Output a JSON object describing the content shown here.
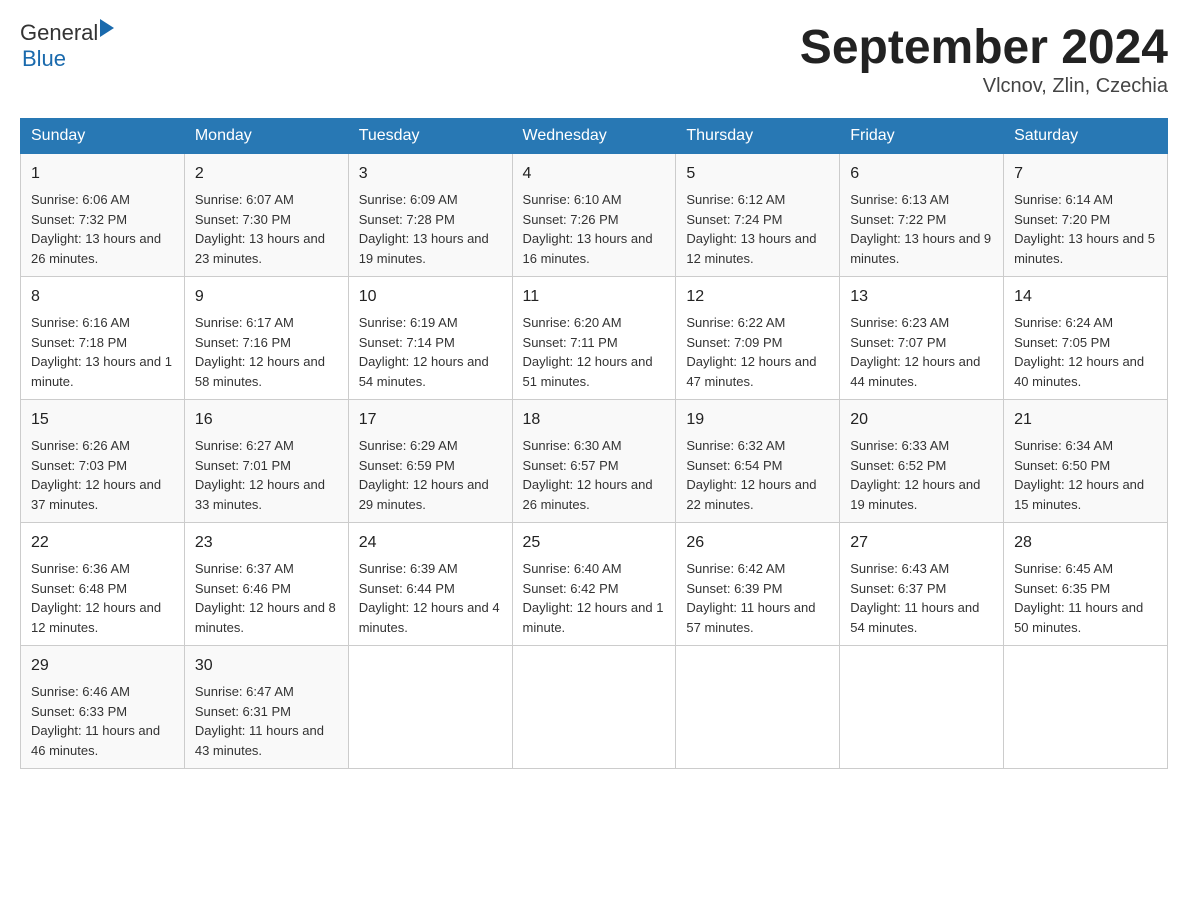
{
  "header": {
    "logo_general": "General",
    "logo_blue": "Blue",
    "month_year": "September 2024",
    "location": "Vlcnov, Zlin, Czechia"
  },
  "days_of_week": [
    "Sunday",
    "Monday",
    "Tuesday",
    "Wednesday",
    "Thursday",
    "Friday",
    "Saturday"
  ],
  "weeks": [
    [
      {
        "day": "1",
        "sunrise": "6:06 AM",
        "sunset": "7:32 PM",
        "daylight": "13 hours and 26 minutes."
      },
      {
        "day": "2",
        "sunrise": "6:07 AM",
        "sunset": "7:30 PM",
        "daylight": "13 hours and 23 minutes."
      },
      {
        "day": "3",
        "sunrise": "6:09 AM",
        "sunset": "7:28 PM",
        "daylight": "13 hours and 19 minutes."
      },
      {
        "day": "4",
        "sunrise": "6:10 AM",
        "sunset": "7:26 PM",
        "daylight": "13 hours and 16 minutes."
      },
      {
        "day": "5",
        "sunrise": "6:12 AM",
        "sunset": "7:24 PM",
        "daylight": "13 hours and 12 minutes."
      },
      {
        "day": "6",
        "sunrise": "6:13 AM",
        "sunset": "7:22 PM",
        "daylight": "13 hours and 9 minutes."
      },
      {
        "day": "7",
        "sunrise": "6:14 AM",
        "sunset": "7:20 PM",
        "daylight": "13 hours and 5 minutes."
      }
    ],
    [
      {
        "day": "8",
        "sunrise": "6:16 AM",
        "sunset": "7:18 PM",
        "daylight": "13 hours and 1 minute."
      },
      {
        "day": "9",
        "sunrise": "6:17 AM",
        "sunset": "7:16 PM",
        "daylight": "12 hours and 58 minutes."
      },
      {
        "day": "10",
        "sunrise": "6:19 AM",
        "sunset": "7:14 PM",
        "daylight": "12 hours and 54 minutes."
      },
      {
        "day": "11",
        "sunrise": "6:20 AM",
        "sunset": "7:11 PM",
        "daylight": "12 hours and 51 minutes."
      },
      {
        "day": "12",
        "sunrise": "6:22 AM",
        "sunset": "7:09 PM",
        "daylight": "12 hours and 47 minutes."
      },
      {
        "day": "13",
        "sunrise": "6:23 AM",
        "sunset": "7:07 PM",
        "daylight": "12 hours and 44 minutes."
      },
      {
        "day": "14",
        "sunrise": "6:24 AM",
        "sunset": "7:05 PM",
        "daylight": "12 hours and 40 minutes."
      }
    ],
    [
      {
        "day": "15",
        "sunrise": "6:26 AM",
        "sunset": "7:03 PM",
        "daylight": "12 hours and 37 minutes."
      },
      {
        "day": "16",
        "sunrise": "6:27 AM",
        "sunset": "7:01 PM",
        "daylight": "12 hours and 33 minutes."
      },
      {
        "day": "17",
        "sunrise": "6:29 AM",
        "sunset": "6:59 PM",
        "daylight": "12 hours and 29 minutes."
      },
      {
        "day": "18",
        "sunrise": "6:30 AM",
        "sunset": "6:57 PM",
        "daylight": "12 hours and 26 minutes."
      },
      {
        "day": "19",
        "sunrise": "6:32 AM",
        "sunset": "6:54 PM",
        "daylight": "12 hours and 22 minutes."
      },
      {
        "day": "20",
        "sunrise": "6:33 AM",
        "sunset": "6:52 PM",
        "daylight": "12 hours and 19 minutes."
      },
      {
        "day": "21",
        "sunrise": "6:34 AM",
        "sunset": "6:50 PM",
        "daylight": "12 hours and 15 minutes."
      }
    ],
    [
      {
        "day": "22",
        "sunrise": "6:36 AM",
        "sunset": "6:48 PM",
        "daylight": "12 hours and 12 minutes."
      },
      {
        "day": "23",
        "sunrise": "6:37 AM",
        "sunset": "6:46 PM",
        "daylight": "12 hours and 8 minutes."
      },
      {
        "day": "24",
        "sunrise": "6:39 AM",
        "sunset": "6:44 PM",
        "daylight": "12 hours and 4 minutes."
      },
      {
        "day": "25",
        "sunrise": "6:40 AM",
        "sunset": "6:42 PM",
        "daylight": "12 hours and 1 minute."
      },
      {
        "day": "26",
        "sunrise": "6:42 AM",
        "sunset": "6:39 PM",
        "daylight": "11 hours and 57 minutes."
      },
      {
        "day": "27",
        "sunrise": "6:43 AM",
        "sunset": "6:37 PM",
        "daylight": "11 hours and 54 minutes."
      },
      {
        "day": "28",
        "sunrise": "6:45 AM",
        "sunset": "6:35 PM",
        "daylight": "11 hours and 50 minutes."
      }
    ],
    [
      {
        "day": "29",
        "sunrise": "6:46 AM",
        "sunset": "6:33 PM",
        "daylight": "11 hours and 46 minutes."
      },
      {
        "day": "30",
        "sunrise": "6:47 AM",
        "sunset": "6:31 PM",
        "daylight": "11 hours and 43 minutes."
      },
      null,
      null,
      null,
      null,
      null
    ]
  ]
}
